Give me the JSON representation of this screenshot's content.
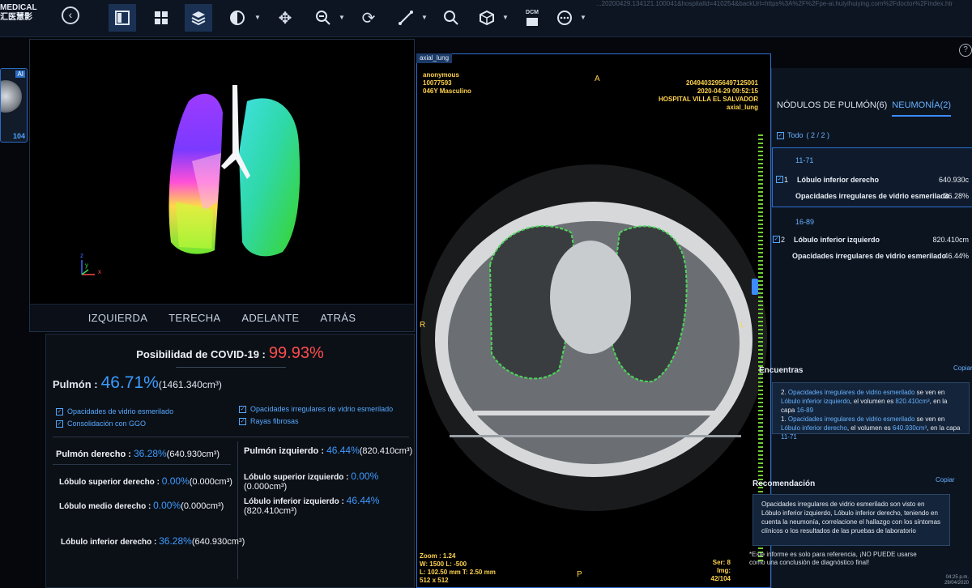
{
  "app": {
    "logo_line1": "MEDICAL",
    "logo_line2": "汇医慧影",
    "url_fragment": "...20200429.134121.100041&hospitalId=410254&backUrl=https%3A%2F%2Fpe-ai.huiyihuiying.com%2Fdoctor%2Findex.html%23%2FimageHom..."
  },
  "toolbar": {
    "icons": [
      "back-icon",
      "layout-single-icon",
      "layout-grid-icon",
      "layers-icon",
      "contrast-icon",
      "move-icon",
      "zoom-icon",
      "rotate-icon",
      "measure-icon",
      "magnify-icon",
      "cube-icon",
      "dcm-icon",
      "more-icon"
    ],
    "dcm_label": "DCM"
  },
  "thumbnail": {
    "tag": "AI",
    "count": "104"
  },
  "panel3d": {
    "views": [
      "IZQUIERDA",
      "TERECHA",
      "ADELANTE",
      "ATRÁS"
    ],
    "axes": {
      "z": "z",
      "y": "y",
      "x": "x"
    }
  },
  "stats": {
    "covid_label": "Posibilidad de COVID-19 :",
    "covid_value": "99.93%",
    "pulmon_label": "Pulmón :",
    "pulmon_value": "46.71%",
    "pulmon_volume": "(1461.340cm³)",
    "legend": [
      {
        "label": "Opacidades de vidrio esmerilado",
        "checked": true
      },
      {
        "label": "Opacidades irregulares de vidrio esmerilado",
        "checked": true
      },
      {
        "label": "Consolidación con GGO",
        "checked": true
      },
      {
        "label": "Rayas fibrosas",
        "checked": true
      }
    ],
    "right_lung": {
      "label": "Pulmón derecho :",
      "value": "36.28%",
      "volume": "(640.930cm³)"
    },
    "left_lung": {
      "label": "Pulmón izquierdo :",
      "value": "46.44%",
      "volume": "(820.410cm³)"
    },
    "lobes": {
      "rsl": {
        "label": "Lóbulo superior derecho :",
        "value": "0.00%",
        "volume": "(0.000cm³)"
      },
      "rml": {
        "label": "Lóbulo medio derecho :",
        "value": "0.00%",
        "volume": "(0.000cm³)"
      },
      "ril": {
        "label": "Lóbulo inferior derecho :",
        "value": "36.28%",
        "volume": "(640.930cm³)"
      },
      "lsl": {
        "label": "Lóbulo superior izquierdo :",
        "value": "0.00%",
        "volume": "(0.000cm³)"
      },
      "lil": {
        "label": "Lóbulo inferior izquierdo :",
        "value": "46.44%",
        "volume": "(820.410cm³)"
      }
    }
  },
  "ct": {
    "tab": "axial_lung",
    "patient": [
      "anonymous",
      "10077593",
      "046Y Masculino"
    ],
    "study": [
      "20494032956497125001",
      "2020-04-29 09:52:15",
      "HOSPITAL VILLA EL SALVADOR",
      "axial_lung"
    ],
    "orient": {
      "top": "A",
      "bottom": "P",
      "left": "R",
      "right": "L"
    },
    "bottom_left": [
      "Zoom : 1.24",
      "W: 1500 L: -500",
      "L: 102.50 mm T: 2.50 mm",
      "512 x 512"
    ],
    "bottom_right": [
      "Ser: 8",
      "Img: 42/104"
    ]
  },
  "right_panel": {
    "tabs": [
      "NÓDULOS DE PULMÓN(6)",
      "NEUMONÍA(2)"
    ],
    "all_label": "Todo",
    "all_count": "( 2 / 2 )",
    "findings": [
      {
        "layer": "11-71",
        "index": "1",
        "lobe": "Lóbulo inferior derecho",
        "volume": "640.930c",
        "type": "Opacidades irregulares de vidrio esmerilado",
        "pct": "36.28%"
      },
      {
        "layer": "16-89",
        "index": "2",
        "lobe": "Lóbulo inferior izquierdo",
        "volume": "820.410cm",
        "type": "Opacidades irregulares de vidrio esmerilado",
        "pct": "46.44%"
      }
    ],
    "encuentras_title": "Encuentras",
    "copy_label": "Copiar",
    "encuentras_text": {
      "p2_a": "2. ",
      "p2_type": "Opacidades irregulares de vidrio esmerilado",
      "p2_b": " se ven en ",
      "p2_lobe": "Lóbulo inferior izquierdo",
      "p2_c": ", el volumen es ",
      "p2_vol": "820.410cm³",
      "p2_d": ", en la capa ",
      "p2_layer": "16-89",
      "p1_a": "1. ",
      "p1_type": "Opacidades irregulares de vidrio esmerilado",
      "p1_b": " se ven en ",
      "p1_lobe": "Lóbulo inferior derecho",
      "p1_c": ", el volumen es ",
      "p1_vol": "640.930cm³",
      "p1_d": ", en la capa ",
      "p1_layer": "11-71"
    },
    "recomendacion_title": "Recomendación",
    "recomendacion_text": "Opacidades irregulares de vidrio esmerilado son visto en Lóbulo inferior izquierdo, Lóbulo inferior derecho, teniendo en cuenta la neumonía, correlacione el hallazgo con los síntomas clínicos o los resultados de las pruebas de laboratorio",
    "note": "*Este informe es solo para referencia, ¡NO PUEDE usarse como una conclusión de diagnóstico final!",
    "clock_time": "04:25 p.m.",
    "clock_date": "29/04/2020"
  }
}
